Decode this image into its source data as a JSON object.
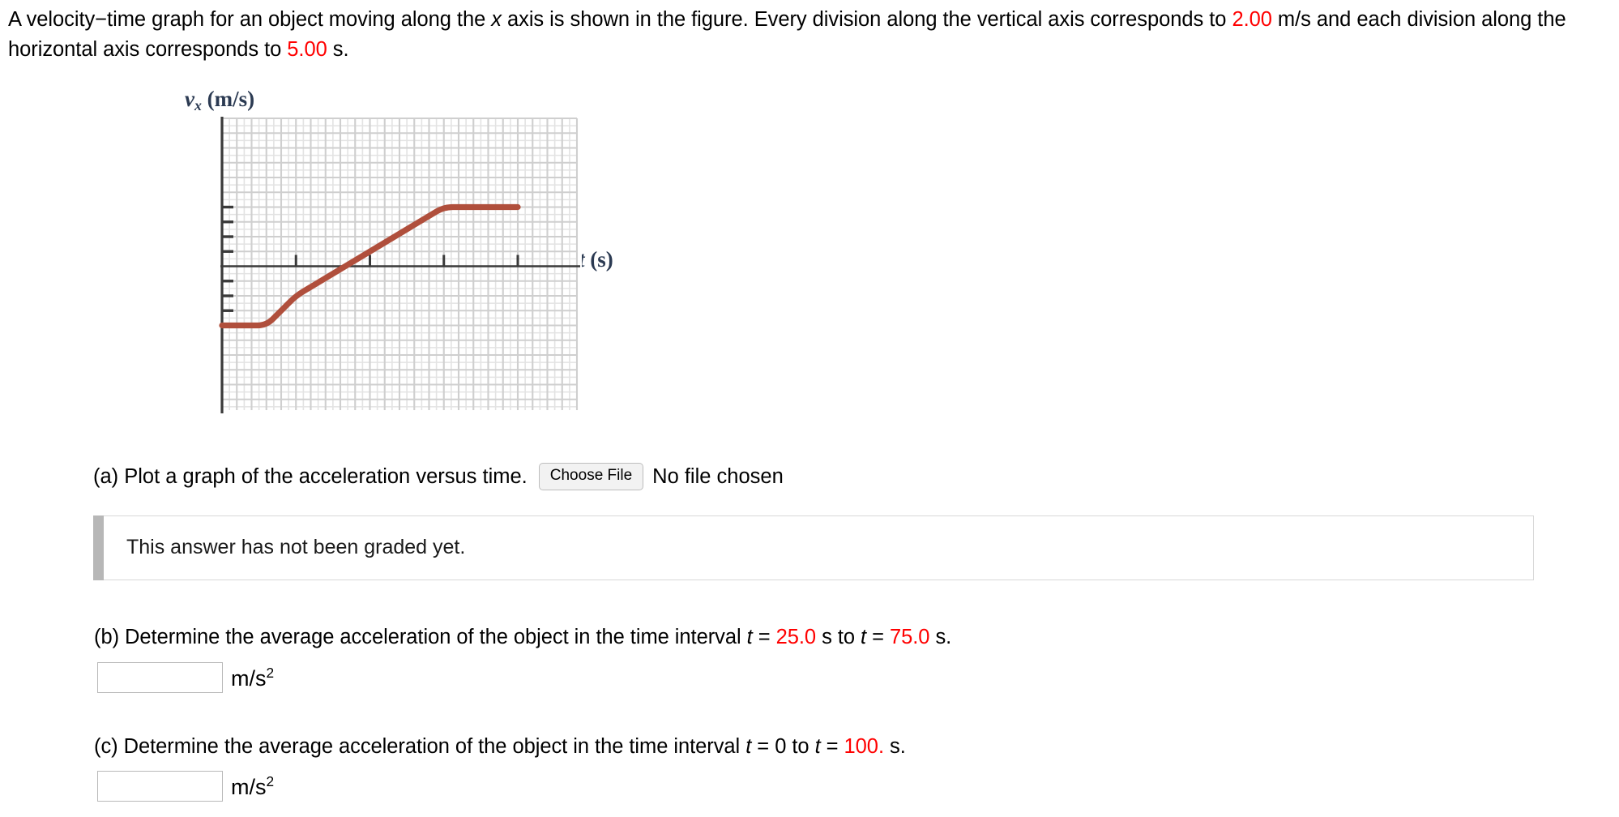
{
  "statement": {
    "seg1": "A velocity−time graph for an object moving along the ",
    "var_x": "x",
    "seg2": " axis is shown in the figure. Every division along the vertical axis corresponds to ",
    "val_vertical": "2.00",
    "seg3": " m/s and each division along the horizontal axis corresponds to ",
    "val_horizontal": "5.00",
    "seg4": " s."
  },
  "figure": {
    "y_axis_label_var": "v",
    "y_axis_label_sub": "x",
    "y_axis_label_unit": " (m/s)",
    "x_axis_label_var": "t",
    "x_axis_label_unit": " (s)",
    "curve_color": "#b04f3c",
    "grid_minor_color": "#e3e3e3",
    "grid_major_color": "#cfcfcf",
    "axis_color": "#3a3a3a"
  },
  "chart_data": {
    "type": "line",
    "title": "",
    "xlabel": "t (s)",
    "ylabel": "v_x (m/s)",
    "xlim": [
      0,
      100
    ],
    "ylim": [
      -10,
      10
    ],
    "x_division_value": 5.0,
    "y_division_value": 2.0,
    "grid": true,
    "legend": "none",
    "x_tick_values": [
      25,
      50,
      75,
      100
    ],
    "y_tick_values": [
      -6,
      -4,
      -2,
      2,
      4,
      6,
      8
    ],
    "series": [
      {
        "name": "v_x",
        "x": [
          0,
          15,
          25,
          75,
          85,
          100
        ],
        "y": [
          -8,
          -8,
          -4,
          8,
          8,
          8
        ],
        "description": "Flat at -8 m/s until t=15 s, curving up to a constant slope of 0.24 m/s^2 crossing zero near t=50 s, leveling off at +8 m/s near t=85 s."
      }
    ]
  },
  "part_a": {
    "label": "(a) Plot a graph of the acceleration versus time.",
    "choose_file_label": "Choose File",
    "no_file_label": "No file chosen"
  },
  "graded": {
    "message": "This answer has not been graded yet."
  },
  "part_b": {
    "seg1": "(b) Determine the average acceleration of the object in the time interval ",
    "t1_var": "t",
    "eq1": " = ",
    "t1_val": "25.0",
    "seg2": " s to ",
    "t2_var": "t",
    "eq2": " = ",
    "t2_val": "75.0",
    "seg3": " s.",
    "input_value": "",
    "input_placeholder": "",
    "units": "m/s",
    "units_exp": "2"
  },
  "part_c": {
    "seg1": "(c) Determine the average acceleration of the object in the time interval ",
    "t1_var": "t",
    "eq1": " = ",
    "t1_val": "0",
    "seg2": " to ",
    "t2_var": "t",
    "eq2": " = ",
    "t2_val": "100.",
    "seg3": " s.",
    "input_value": "",
    "input_placeholder": "",
    "units": "m/s",
    "units_exp": "2"
  }
}
